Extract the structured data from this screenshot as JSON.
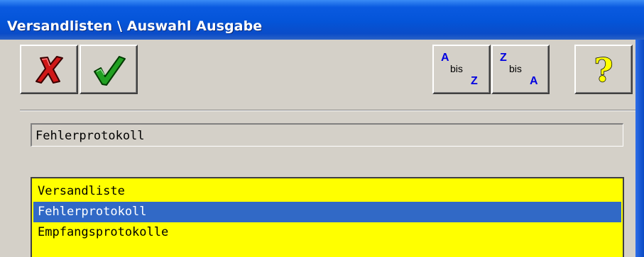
{
  "window": {
    "title": "Versandlisten \\ Auswahl Ausgabe"
  },
  "toolbar": {
    "cancel": {
      "icon": "red-x-icon"
    },
    "confirm": {
      "icon": "green-check-icon"
    },
    "sort_az": {
      "top": "A",
      "middle": "bis",
      "bottom": "Z"
    },
    "sort_za": {
      "top": "Z",
      "middle": "bis",
      "bottom": "A"
    },
    "help": {
      "icon": "question-mark-icon"
    }
  },
  "selection": {
    "value": "Fehlerprotokoll"
  },
  "list": {
    "items": [
      {
        "label": "Versandliste",
        "selected": false
      },
      {
        "label": "Fehlerprotokoll",
        "selected": true
      },
      {
        "label": "Empfangsprotokolle",
        "selected": false
      }
    ]
  },
  "colors": {
    "titlebar": "#0454d8",
    "list_background": "#ffff00",
    "selection_highlight": "#3169c6",
    "window_background": "#d4d0c8"
  }
}
